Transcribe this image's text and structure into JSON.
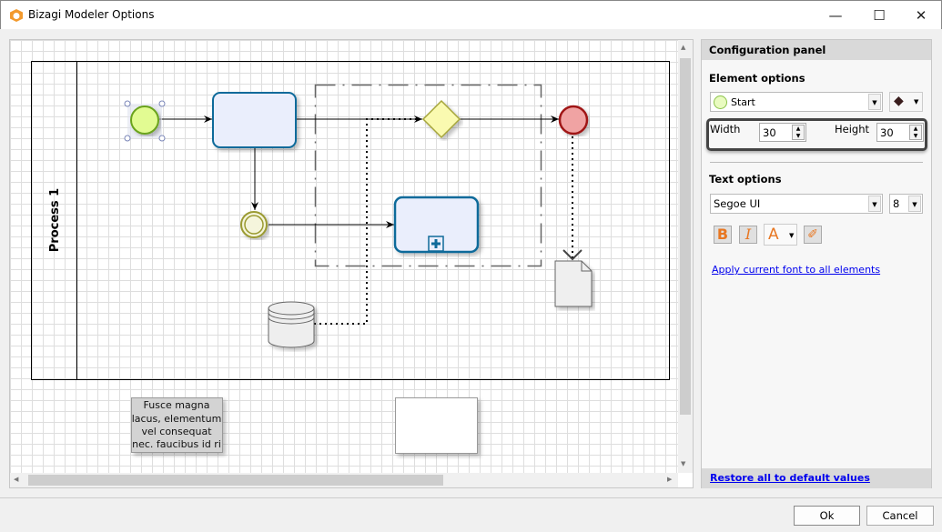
{
  "window": {
    "title": "Bizagi Modeler Options",
    "minimize": "—",
    "maximize": "☐",
    "close": "✕"
  },
  "diagram": {
    "pool_label": "Process 1",
    "annotation_text": [
      "Fusce magna",
      "lacus, elementum",
      "vel consequat",
      "nec. faucibus id ri"
    ]
  },
  "panel": {
    "header": "Configuration panel",
    "element_options": "Element options",
    "element_selected": "Start",
    "width_label": "Width",
    "width_value": "30",
    "height_label": "Height",
    "height_value": "30",
    "text_options": "Text options",
    "font": "Segoe UI",
    "font_size": "8",
    "bold": "B",
    "italic": "I",
    "font_color": "A",
    "apply_link": "Apply current font to all elements",
    "restore_link": "Restore all to default values"
  },
  "footer": {
    "ok": "Ok",
    "cancel": "Cancel"
  },
  "colors": {
    "accent": "#e87722",
    "task_stroke": "#0f6a9a",
    "link": "#0000ee"
  }
}
